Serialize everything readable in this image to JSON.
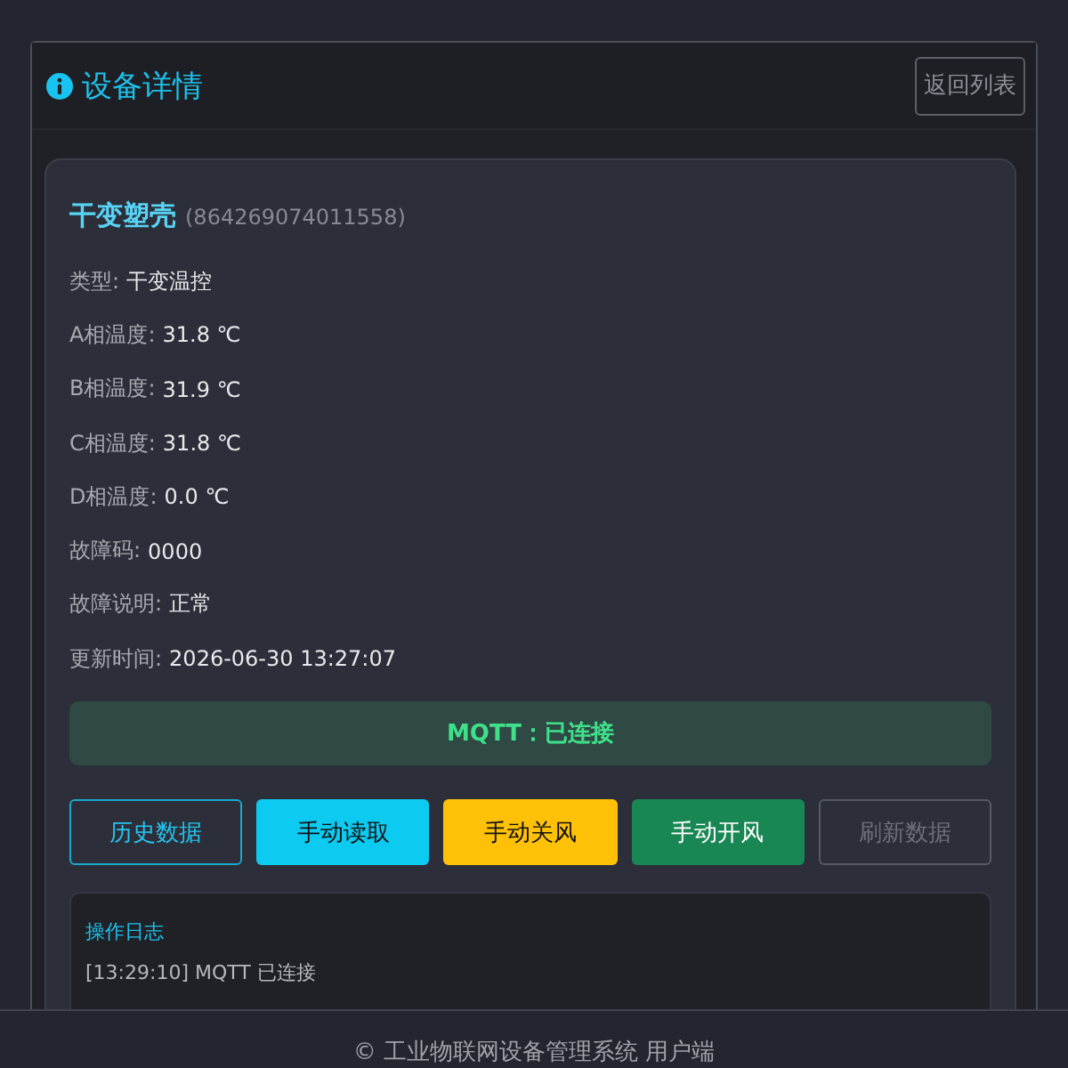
{
  "panel": {
    "title": "设备详情",
    "back_button": "返回列表"
  },
  "device": {
    "name": "干变塑壳",
    "id": "(864269074011558)",
    "fields": [
      {
        "label": "类型:",
        "value": "干变温控"
      },
      {
        "label": "A相温度:",
        "value": "31.8 ℃"
      },
      {
        "label": "B相温度:",
        "value": "31.9 ℃"
      },
      {
        "label": "C相温度:",
        "value": "31.8 ℃"
      },
      {
        "label": "D相温度:",
        "value": "0.0 ℃"
      },
      {
        "label": "故障码:",
        "value": "0000"
      },
      {
        "label": "故障说明:",
        "value": "正常"
      },
      {
        "label": "更新时间:",
        "value": "2026-06-30 13:27:07"
      }
    ]
  },
  "mqtt_status": {
    "text": "MQTT：已连接",
    "connected": true
  },
  "buttons": [
    {
      "label": "历史数据",
      "kind": "outline",
      "disabled": false
    },
    {
      "label": "手动读取",
      "kind": "info",
      "disabled": false
    },
    {
      "label": "手动关风",
      "kind": "warning",
      "disabled": false
    },
    {
      "label": "手动开风",
      "kind": "success",
      "disabled": false
    },
    {
      "label": "刷新数据",
      "kind": "outline",
      "disabled": true
    }
  ],
  "log": {
    "title": "操作日志",
    "entries": [
      "[13:29:10] MQTT 已连接"
    ]
  },
  "footer": "© 工业物联网设备管理系统 用户端"
}
